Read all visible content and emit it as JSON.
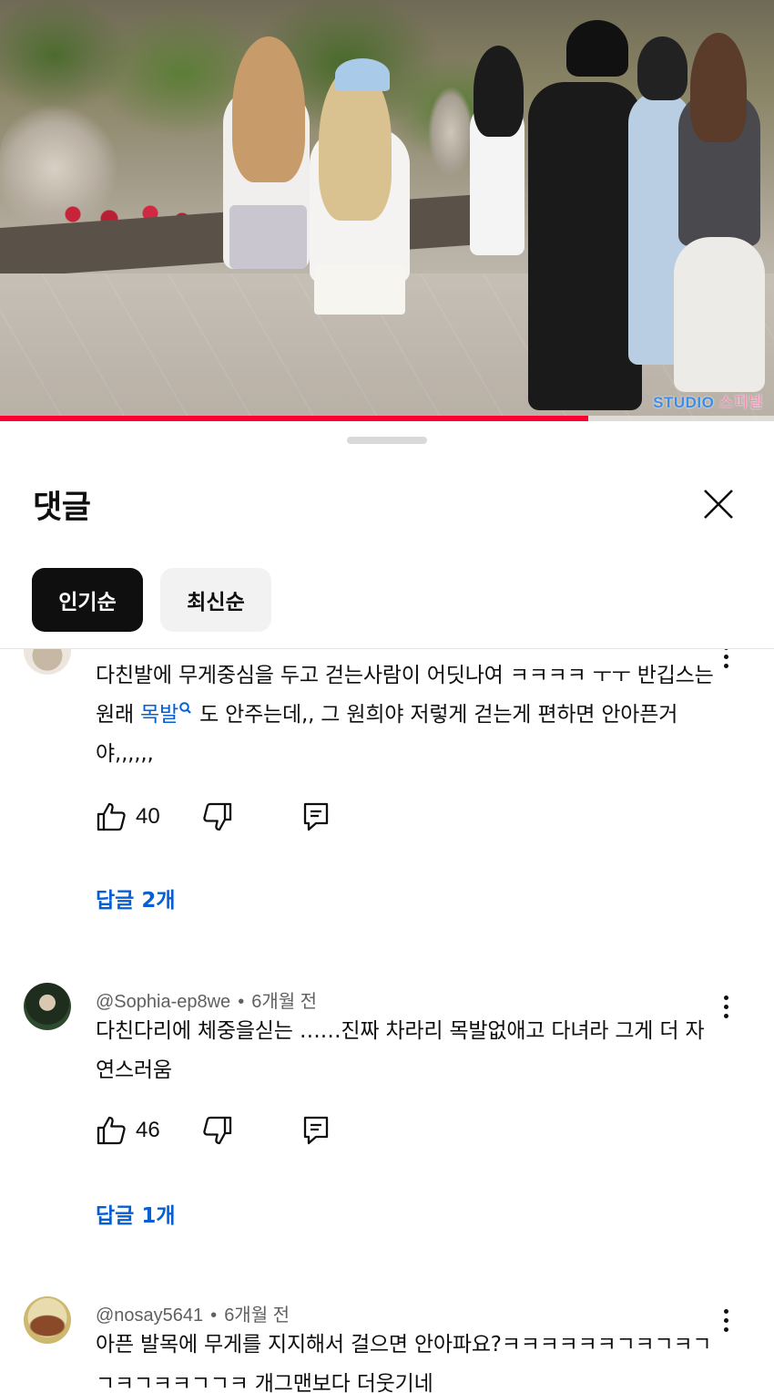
{
  "video": {
    "watermark_brand": "STUDIO",
    "watermark_suffix": "스피넬",
    "progress_fraction": 0.76
  },
  "sheet": {
    "title": "댓글",
    "close_icon": "close-icon",
    "sort_chips": [
      {
        "label": "인기순",
        "selected": true
      },
      {
        "label": "최신순",
        "selected": false
      }
    ]
  },
  "comments": [
    {
      "author": "",
      "age": "",
      "text_before_link": "다친발에 무게중심을 두고 걷는사람이 어딧나여 ㅋㅋㅋㅋ ㅜㅜ 반깁스는 원래 ",
      "link_text": "목발",
      "text_after_link": " 도 안주는데,, 그 원희야 저렇게 걷는게 편하면 안아픈거야,,,,,,",
      "likes": "40",
      "replies": "답글 2개"
    },
    {
      "author": "@Sophia-ep8we",
      "age": "6개월 전",
      "text": "다친다리에 체중을싣는 ……진짜 차라리 목발없애고 다녀라 그게 더 자연스러움",
      "likes": "46",
      "replies": "답글 1개"
    },
    {
      "author": "@nosay5641",
      "age": "6개월 전",
      "text": "아픈 발목에 무게를 지지해서 걸으면 안아파요?ㅋㅋㅋㅋㅋㅋㄱㅋㄱㅋㄱㄱㅋㄱㅋㅋㄱㄱㅋ 개그맨보다 더웃기네"
    }
  ],
  "colors": {
    "accent_red": "#ff0033",
    "link_blue": "#065fd4",
    "chip_active": "#0f0f0f",
    "chip_inactive": "#f2f2f2",
    "meta_gray": "#606060"
  },
  "icons": [
    "like-icon",
    "dislike-icon",
    "reply-icon",
    "more-vert-icon",
    "search-link-icon"
  ]
}
